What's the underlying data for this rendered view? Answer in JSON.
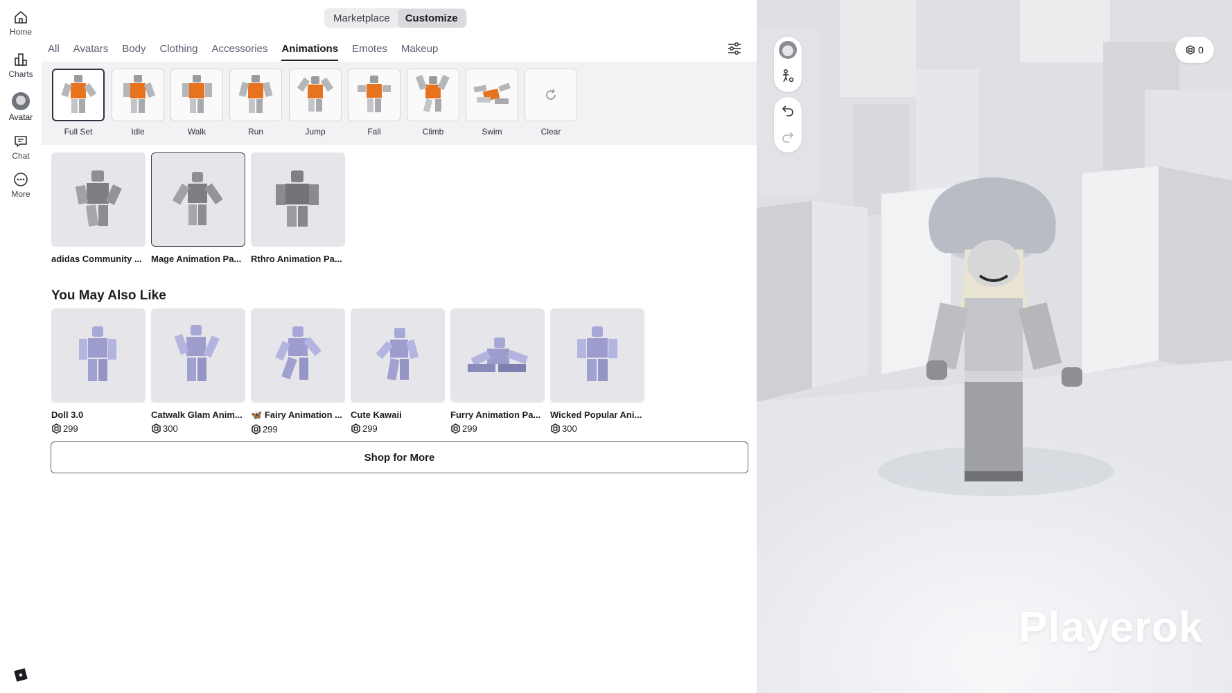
{
  "rail": {
    "items": [
      {
        "label": "Home",
        "icon": "home-icon"
      },
      {
        "label": "Charts",
        "icon": "charts-icon"
      },
      {
        "label": "Avatar",
        "icon": "avatar-icon"
      },
      {
        "label": "Chat",
        "icon": "chat-icon"
      },
      {
        "label": "More",
        "icon": "more-icon"
      }
    ],
    "active": "Avatar"
  },
  "header": {
    "segments": [
      "Marketplace",
      "Customize"
    ],
    "active_segment": "Customize"
  },
  "category_tabs": {
    "items": [
      "All",
      "Avatars",
      "Body",
      "Clothing",
      "Accessories",
      "Animations",
      "Emotes",
      "Makeup"
    ],
    "active": "Animations"
  },
  "animation_types": {
    "items": [
      "Full Set",
      "Idle",
      "Walk",
      "Run",
      "Jump",
      "Fall",
      "Climb",
      "Swim",
      "Clear"
    ],
    "active": "Full Set"
  },
  "owned_items": [
    {
      "name": "adidas Community ..."
    },
    {
      "name": "Mage Animation Pa..."
    },
    {
      "name": "Rthro Animation Pa..."
    }
  ],
  "recommendations": {
    "title": "You May Also Like",
    "items": [
      {
        "name": "Doll 3.0",
        "price": "299"
      },
      {
        "name": "Catwalk Glam Anim...",
        "price": "300"
      },
      {
        "name": "Fairy Animation ...",
        "prefix_emoji": "🦋",
        "price": "299"
      },
      {
        "name": "Cute Kawaii",
        "price": "299"
      },
      {
        "name": "Furry Animation Pa...",
        "price": "299"
      },
      {
        "name": "Wicked Popular Ani...",
        "price": "300"
      }
    ]
  },
  "shop_more_label": "Shop for More",
  "viewport": {
    "robux_balance": "0",
    "username": "Playerok"
  },
  "colors": {
    "accent_orange": "#e8731f",
    "rig_purple": "#a8a8d8",
    "rig_gray": "#8e8f93"
  }
}
